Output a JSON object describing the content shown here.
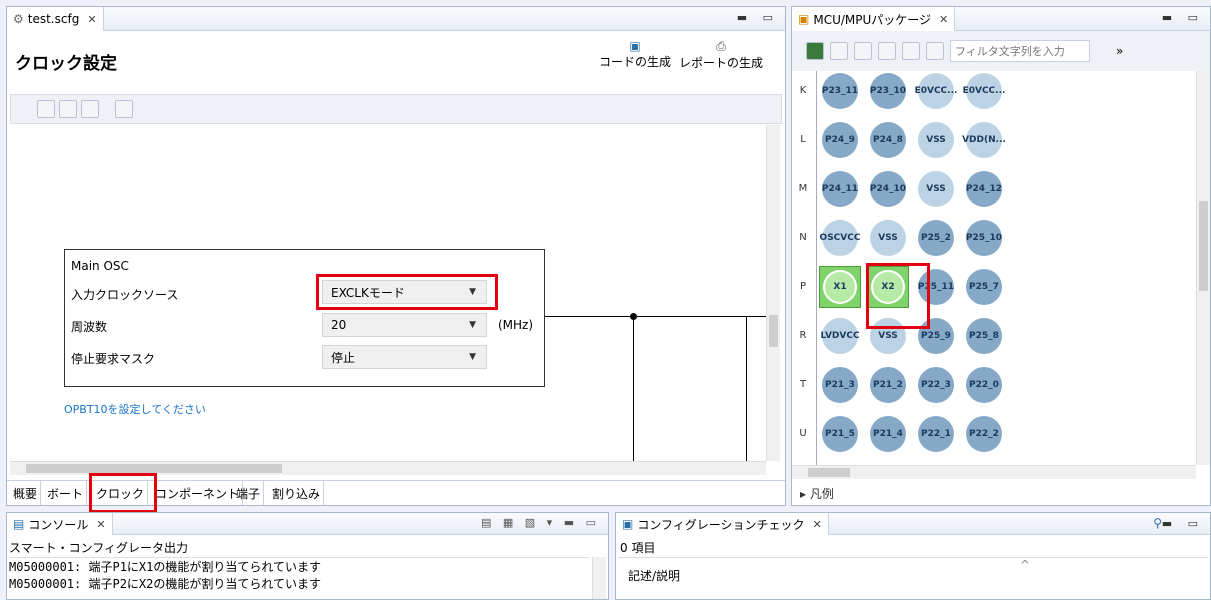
{
  "editor": {
    "tab_label": "test.scfg",
    "title": "クロック設定",
    "gen_code_label": "コードの生成",
    "gen_report_label": "レポートの生成",
    "main_osc": {
      "title": "Main OSC",
      "input_source_label": "入力クロックソース",
      "input_source_value": "EXCLKモード",
      "frequency_label": "周波数",
      "frequency_value": "20",
      "frequency_unit": "(MHz)",
      "stop_mask_label": "停止要求マスク",
      "stop_mask_value": "停止"
    },
    "link_text": "OPBT10を設定してください",
    "bottom_tabs": [
      "概要",
      "ボート",
      "クロック",
      "コンポーネント",
      "端子",
      "割り込み"
    ]
  },
  "mcu": {
    "tab_label": "MCU/MPUパッケージ",
    "filter_placeholder": "フィルタ文字列を入力",
    "legend_label": "▸ 凡例",
    "rows": [
      {
        "label": "K",
        "pins": [
          {
            "name": "P23_11",
            "style": "dark"
          },
          {
            "name": "P23_10",
            "style": "dark"
          },
          {
            "name": "E0VCC...",
            "style": "light"
          },
          {
            "name": "E0VCC...",
            "style": "light"
          }
        ]
      },
      {
        "label": "L",
        "pins": [
          {
            "name": "P24_9",
            "style": "dark"
          },
          {
            "name": "P24_8",
            "style": "dark"
          },
          {
            "name": "VSS",
            "style": "light"
          },
          {
            "name": "VDD(N...",
            "style": "light"
          }
        ]
      },
      {
        "label": "M",
        "pins": [
          {
            "name": "P24_11",
            "style": "dark"
          },
          {
            "name": "P24_10",
            "style": "dark"
          },
          {
            "name": "VSS",
            "style": "light"
          },
          {
            "name": "P24_12",
            "style": "dark"
          }
        ]
      },
      {
        "label": "N",
        "pins": [
          {
            "name": "OSCVCC",
            "style": "light"
          },
          {
            "name": "VSS",
            "style": "light"
          },
          {
            "name": "P25_2",
            "style": "dark"
          },
          {
            "name": "P25_10",
            "style": "dark"
          }
        ]
      },
      {
        "label": "P",
        "pins": [
          {
            "name": "X1",
            "style": "green"
          },
          {
            "name": "X2",
            "style": "green"
          },
          {
            "name": "P25_11",
            "style": "dark"
          },
          {
            "name": "P25_7",
            "style": "dark"
          }
        ]
      },
      {
        "label": "R",
        "pins": [
          {
            "name": "LVDVCC",
            "style": "light"
          },
          {
            "name": "VSS",
            "style": "light"
          },
          {
            "name": "P25_9",
            "style": "dark"
          },
          {
            "name": "P25_8",
            "style": "dark"
          }
        ]
      },
      {
        "label": "T",
        "pins": [
          {
            "name": "P21_3",
            "style": "dark"
          },
          {
            "name": "P21_2",
            "style": "dark"
          },
          {
            "name": "P22_3",
            "style": "dark"
          },
          {
            "name": "P22_0",
            "style": "dark"
          }
        ]
      },
      {
        "label": "U",
        "pins": [
          {
            "name": "P21_5",
            "style": "dark"
          },
          {
            "name": "P21_4",
            "style": "dark"
          },
          {
            "name": "P22_1",
            "style": "dark"
          },
          {
            "name": "P22_2",
            "style": "dark"
          }
        ]
      }
    ]
  },
  "console": {
    "tab_label": "コンソール",
    "title": "スマート・コンフィグレータ出力",
    "lines": [
      "M05000001: 端子P1にX1の機能が割り当てられています",
      "M05000001: 端子P2にX2の機能が割り当てられています"
    ]
  },
  "config_check": {
    "tab_label": "コンフィグレーションチェック",
    "count": "0 項目",
    "column_header": "記述/説明"
  },
  "colors": {
    "accent_red": "#e3000f",
    "pin_dark": "#86a9c8",
    "pin_light": "#bcd3e6",
    "pin_green": "#7fd36a",
    "link_blue": "#1a73c9"
  }
}
